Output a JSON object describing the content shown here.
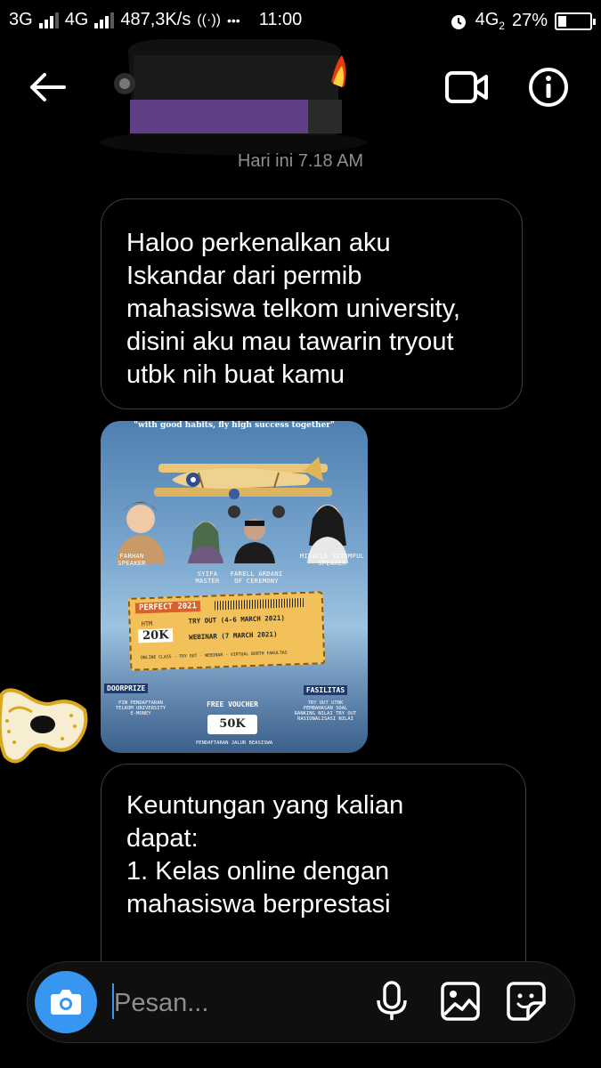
{
  "status_bar": {
    "net1": "3G",
    "net2": "4G",
    "speed": "487,3K/s",
    "hotspot": "((·))",
    "dots": "•••",
    "time": "11:00",
    "net3": "4G",
    "net3_sub": "2",
    "battery": "27%",
    "battery_level_percent": 27
  },
  "header": {
    "timestamp": "Hari ini 7.18 AM"
  },
  "messages": [
    {
      "text": "Haloo perkenalkan aku\nIskandar dari permib\nmahasiswa telkom university,\ndisini aku mau tawarin tryout\nutbk nih buat kamu"
    },
    {
      "text": "Keuntungan yang kalian\ndapat:\n1. Kelas online dengan\nmahasiswa berprestasi"
    }
  ],
  "poster": {
    "tagline": "\"with good habits, fly high success together\"",
    "people": [
      {
        "name": "FARHAN",
        "role": "SPEAKER"
      },
      {
        "name": "SYIFA",
        "role": "MASTER"
      },
      {
        "name": "FARELL ARDANI",
        "role": "OF CEREMONY"
      },
      {
        "name": "MIRACLE SITOMPUL",
        "role": "SPEAKER"
      }
    ],
    "ticket_title": "PERFECT 2021",
    "htm_label": "HTM",
    "price": "20K",
    "tryout": "TRY OUT (4-6 MARCH 2021)",
    "webinar": "WEBINAR (7 MARCH 2021)",
    "features": "ONLINE CLASS - TRY OUT - WEBINAR - VIRTUAL BOOTH FAKULTAS",
    "doorprize_title": "DOORPRIZE",
    "doorprize_items": "PIN PENDAFTARAN\nTELKOM UNIVERSITY\nE-MONEY",
    "voucher_title": "FREE VOUCHER",
    "voucher_value": "50K",
    "voucher_note": "PENDAFTARAN JALUR BEASISWA",
    "fasilitas_title": "FASILITAS",
    "fasilitas_items": "TRY OUT UTBK\nPEMBAHASAN SOAL\nRANKING NILAI TRY OUT\nRASIONALISASI NILAI"
  },
  "composer": {
    "placeholder": "Pesan..."
  },
  "colors": {
    "accent": "#3797f0",
    "bubble_border": "#3d3d3d",
    "background": "#000000"
  },
  "icons": [
    "back-arrow-icon",
    "video-call-icon",
    "info-icon",
    "camera-icon",
    "microphone-icon",
    "gallery-icon",
    "sticker-icon"
  ]
}
